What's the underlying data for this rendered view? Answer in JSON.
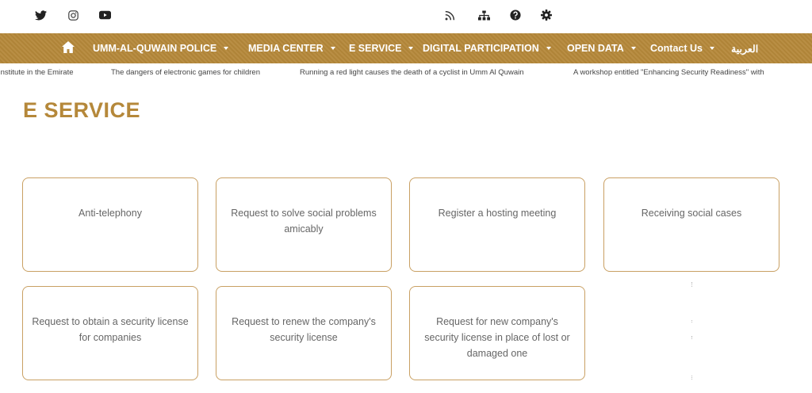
{
  "topbar": {
    "icons": [
      "twitter-icon",
      "instagram-icon",
      "youtube-icon",
      "rss-icon",
      "sitemap-icon",
      "help-icon",
      "settings-icon"
    ]
  },
  "nav": {
    "home_icon": "home-icon",
    "items": [
      {
        "label": "UMM-AL-QUWAIN POLICE"
      },
      {
        "label": "MEDIA CENTER"
      },
      {
        "label": "E SERVICE"
      },
      {
        "label": "DIGITAL PARTICIPATION"
      },
      {
        "label": "OPEN DATA"
      },
      {
        "label": "Contact Us"
      }
    ],
    "language": "العربية",
    "background": "#b5883a"
  },
  "ticker": {
    "items": [
      "Institute in the Emirate",
      "The dangers of electronic games for children",
      "Running a red light causes the death of a cyclist in Umm Al Quwain",
      "A workshop entitled \"Enhancing Security Readiness\" with"
    ]
  },
  "page": {
    "title": "E SERVICE",
    "accent": "#b5883a"
  },
  "services": [
    {
      "label": "Anti-telephony"
    },
    {
      "label": "Request to solve social problems amicably"
    },
    {
      "label": "Register a hosting meeting"
    },
    {
      "label": "Receiving social cases"
    },
    {
      "label": "Request to obtain a security license for companies"
    },
    {
      "label": "Request to renew the company's security license"
    },
    {
      "label": "Request for new company's security license in place of lost or damaged one"
    }
  ]
}
